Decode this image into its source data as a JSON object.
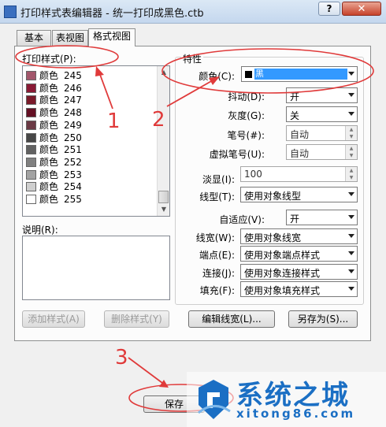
{
  "window": {
    "title": "打印样式表编辑器 - 统一打印成黑色.ctb",
    "help_label": "?",
    "close_label": "✕"
  },
  "tabs": [
    {
      "label": "基本"
    },
    {
      "label": "表视图"
    },
    {
      "label": "格式视图",
      "active": true
    }
  ],
  "print_styles": {
    "label": "打印样式(P):",
    "items": [
      {
        "name": "颜色",
        "number": "245",
        "color": "#a2566b"
      },
      {
        "name": "颜色",
        "number": "246",
        "color": "#8a1a35"
      },
      {
        "name": "颜色",
        "number": "247",
        "color": "#7a1a2a"
      },
      {
        "name": "颜色",
        "number": "248",
        "color": "#641024"
      },
      {
        "name": "颜色",
        "number": "249",
        "color": "#6b3a45"
      },
      {
        "name": "颜色",
        "number": "250",
        "color": "#474747"
      },
      {
        "name": "颜色",
        "number": "251",
        "color": "#616161"
      },
      {
        "name": "颜色",
        "number": "252",
        "color": "#808080"
      },
      {
        "name": "颜色",
        "number": "253",
        "color": "#a3a3a3"
      },
      {
        "name": "颜色",
        "number": "254",
        "color": "#cfcfcf"
      },
      {
        "name": "颜色",
        "number": "255",
        "color": "#ffffff"
      }
    ]
  },
  "description": {
    "label": "说明(R):",
    "value": ""
  },
  "properties": {
    "group_label": "特性",
    "color": {
      "label": "颜色(C):",
      "value": "黑"
    },
    "dither": {
      "label": "抖动(D):",
      "value": "开"
    },
    "grayscale": {
      "label": "灰度(G):",
      "value": "关"
    },
    "pen_number": {
      "label": "笔号(#):",
      "value": "自动"
    },
    "virtual_pen": {
      "label": "虚拟笔号(U):",
      "value": "自动"
    },
    "screening": {
      "label": "淡显(I):",
      "value": "100"
    },
    "linetype": {
      "label": "线型(T):",
      "value": "使用对象线型"
    },
    "adaptive": {
      "label": "自适应(V):",
      "value": "开"
    },
    "lineweight": {
      "label": "线宽(W):",
      "value": "使用对象线宽"
    },
    "endpoint": {
      "label": "端点(E):",
      "value": "使用对象端点样式"
    },
    "join": {
      "label": "连接(J):",
      "value": "使用对象连接样式"
    },
    "fill": {
      "label": "填充(F):",
      "value": "使用对象填充样式"
    }
  },
  "buttons": {
    "add_style": "添加样式(A)",
    "delete_style": "删除样式(Y)",
    "edit_lineweights": "编辑线宽(L)...",
    "save_as": "另存为(S)...",
    "save": "保存"
  },
  "annotations": {
    "n1": "1",
    "n2": "2",
    "n3": "3",
    "color": "#e03a3a"
  },
  "watermark": {
    "title": "系统之城",
    "url": "xitong86.com"
  }
}
